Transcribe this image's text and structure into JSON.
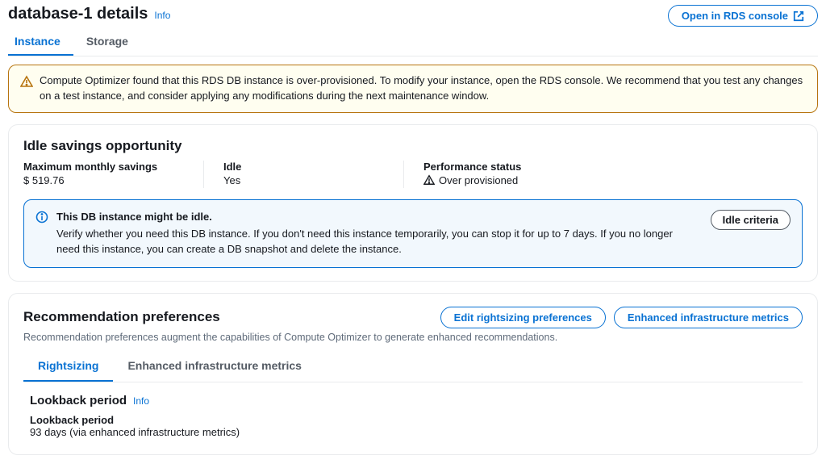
{
  "header": {
    "title": "database-1 details",
    "info_label": "Info",
    "open_console_label": "Open in RDS console"
  },
  "tabs": [
    {
      "label": "Instance",
      "active": true
    },
    {
      "label": "Storage",
      "active": false
    }
  ],
  "warning_banner": {
    "text": "Compute Optimizer found that this RDS DB instance is over-provisioned. To modify your instance, open the RDS console. We recommend that you test any changes on a test instance, and consider applying any modifications during the next maintenance window."
  },
  "idle_panel": {
    "title": "Idle savings opportunity",
    "metrics": {
      "savings_label": "Maximum monthly savings",
      "savings_value": "$ 519.76",
      "idle_label": "Idle",
      "idle_value": "Yes",
      "status_label": "Performance status",
      "status_value": "Over provisioned"
    },
    "info_alert": {
      "title": "This DB instance might be idle.",
      "body": "Verify whether you need this DB instance. If you don't need this instance temporarily, you can stop it for up to 7 days. If you no longer need this instance, you can create a DB snapshot and delete the instance.",
      "button_label": "Idle criteria"
    }
  },
  "recommendation_panel": {
    "title": "Recommendation preferences",
    "subtitle": "Recommendation preferences augment the capabilities of Compute Optimizer to generate enhanced recommendations.",
    "edit_button": "Edit rightsizing preferences",
    "metrics_button": "Enhanced infrastructure metrics",
    "tabs": [
      {
        "label": "Rightsizing",
        "active": true
      },
      {
        "label": "Enhanced infrastructure metrics",
        "active": false
      }
    ],
    "lookback": {
      "title": "Lookback period",
      "info_label": "Info",
      "label": "Lookback period",
      "value": "93 days (via enhanced infrastructure metrics)"
    }
  }
}
